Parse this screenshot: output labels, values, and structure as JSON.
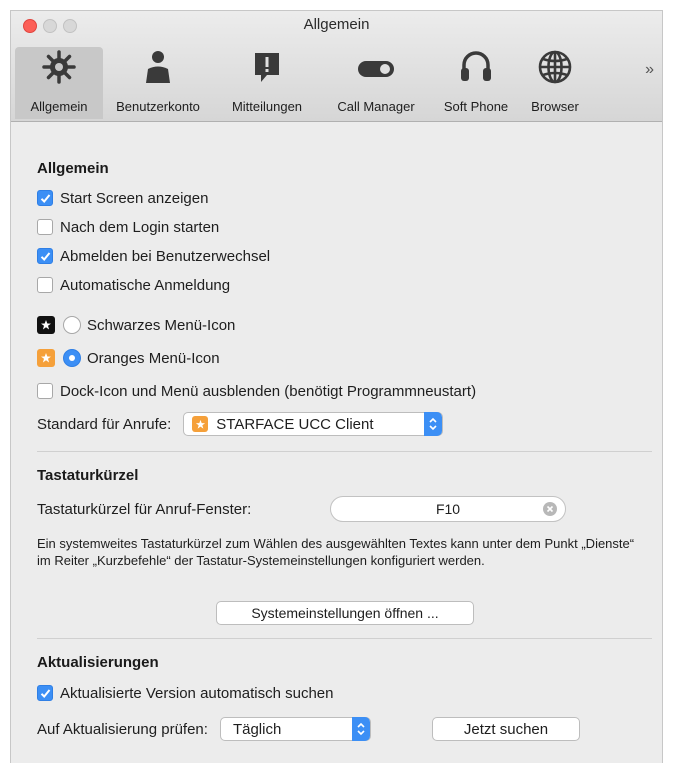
{
  "window": {
    "title": "Allgemein"
  },
  "toolbar": {
    "items": [
      {
        "label": "Allgemein",
        "icon": "gear-icon",
        "selected": true
      },
      {
        "label": "Benutzerkonto",
        "icon": "user-icon"
      },
      {
        "label": "Mitteilungen",
        "icon": "notification-icon"
      },
      {
        "label": "Call Manager",
        "icon": "toggle-icon"
      },
      {
        "label": "Soft Phone",
        "icon": "headset-icon"
      },
      {
        "label": "Browser",
        "icon": "globe-icon"
      }
    ],
    "overflow": "»"
  },
  "general": {
    "heading": "Allgemein",
    "start_screen": {
      "label": "Start Screen anzeigen",
      "checked": true
    },
    "start_after_login": {
      "label": "Nach dem Login starten",
      "checked": false
    },
    "logout_on_user_switch": {
      "label": "Abmelden bei Benutzerwechsel",
      "checked": true
    },
    "auto_login": {
      "label": "Automatische Anmeldung",
      "checked": false
    },
    "black_menu_icon": {
      "label": "Schwarzes Menü-Icon",
      "selected": false
    },
    "orange_menu_icon": {
      "label": "Oranges Menü-Icon",
      "selected": true
    },
    "hide_dock": {
      "label": "Dock-Icon und Menü ausblenden (benötigt Programmneustart)",
      "checked": false
    },
    "default_calls_label": "Standard für Anrufe:",
    "default_calls_value": "STARFACE UCC Client"
  },
  "shortcuts": {
    "heading": "Tastaturkürzel",
    "call_window_label": "Tastaturkürzel für Anruf-Fenster:",
    "call_window_value": "F10",
    "description": "Ein systemweites Tastaturkürzel zum Wählen des ausgewählten Textes kann unter dem Punkt „Dienste“ im Reiter „Kurzbefehle“ der Tastatur-Systemeinstellungen konfiguriert werden.",
    "open_settings_button": "Systemeinstellungen öffnen ..."
  },
  "updates": {
    "heading": "Aktualisierungen",
    "auto_check": {
      "label": "Aktualisierte Version automatisch suchen",
      "checked": true
    },
    "check_label": "Auf Aktualisierung prüfen:",
    "check_value": "Täglich",
    "search_now_button": "Jetzt suchen"
  },
  "colors": {
    "accent": "#3c8ff5",
    "starface_orange": "#f5a03a",
    "close": "#fc5f57"
  }
}
